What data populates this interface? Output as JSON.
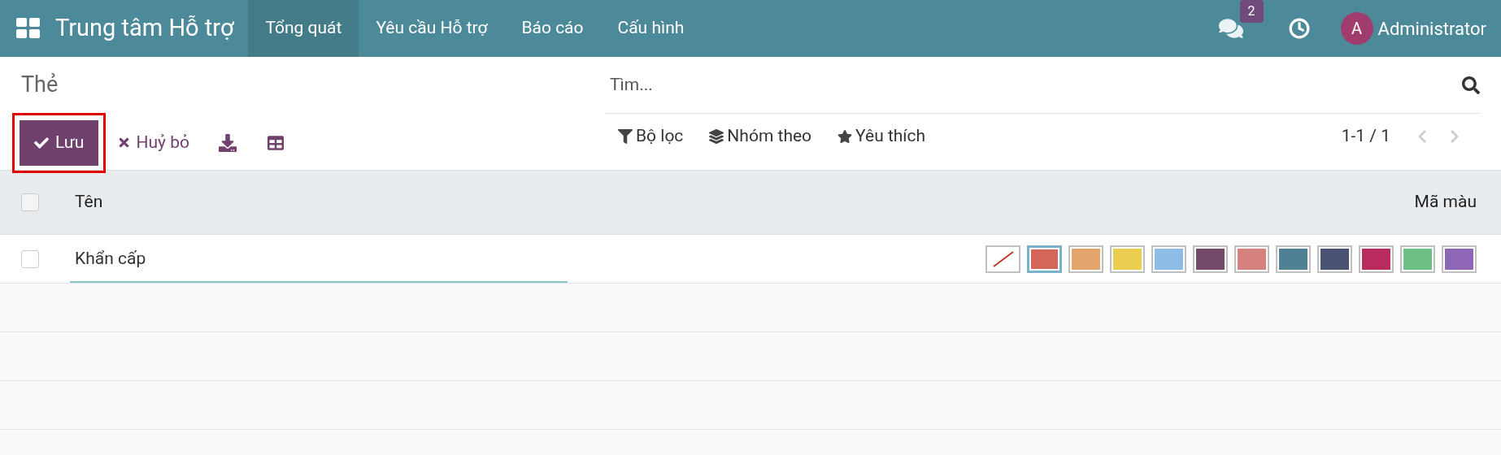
{
  "navbar": {
    "app_title": "Trung tâm Hỗ trợ",
    "menu": [
      {
        "label": "Tổng quát",
        "selected": true
      },
      {
        "label": "Yêu cầu Hỗ trợ",
        "selected": false
      },
      {
        "label": "Báo cáo",
        "selected": false
      },
      {
        "label": "Cấu hình",
        "selected": false
      }
    ],
    "messages_badge": "2",
    "user": {
      "initial": "A",
      "name": "Administrator"
    }
  },
  "breadcrumb": "Thẻ",
  "buttons": {
    "save": "Lưu",
    "discard": "Huỷ bỏ"
  },
  "search": {
    "placeholder": "Tìm..."
  },
  "filters": [
    "Bộ lọc",
    "Nhóm theo",
    "Yêu thích"
  ],
  "pager": "1-1 / 1",
  "table": {
    "select_all_checked": false,
    "columns": [
      "Tên",
      "Mã màu"
    ],
    "rows": [
      {
        "name": "Khẩn cấp",
        "checked": false,
        "swatches": [
          {
            "kind": "none",
            "selected": false
          },
          {
            "kind": "color",
            "color": "#d6665a",
            "selected": true
          },
          {
            "kind": "color",
            "color": "#e2a56b",
            "selected": false
          },
          {
            "kind": "color",
            "color": "#ebcd4f",
            "selected": false
          },
          {
            "kind": "color",
            "color": "#8dbde7",
            "selected": false
          },
          {
            "kind": "color",
            "color": "#744a68",
            "selected": false
          },
          {
            "kind": "color",
            "color": "#d5817e",
            "selected": false
          },
          {
            "kind": "color",
            "color": "#4f8093",
            "selected": false
          },
          {
            "kind": "color",
            "color": "#4a5373",
            "selected": false
          },
          {
            "kind": "color",
            "color": "#b92b5e",
            "selected": false
          },
          {
            "kind": "color",
            "color": "#6cbf85",
            "selected": false
          },
          {
            "kind": "color",
            "color": "#8d67b5",
            "selected": false
          }
        ]
      }
    ]
  }
}
